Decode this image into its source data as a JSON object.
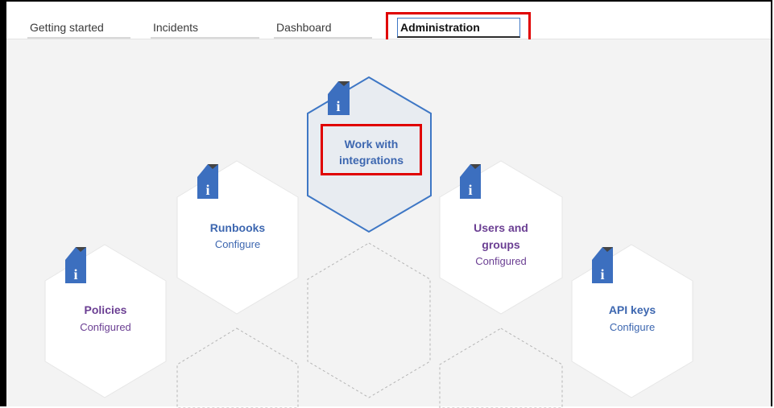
{
  "tabs": {
    "getting_started": "Getting started",
    "incidents": "Incidents",
    "dashboard": "Dashboard",
    "administration": "Administration"
  },
  "tiles": {
    "work_with_integrations": {
      "title": "Work with integrations",
      "title_line1": "Work with",
      "title_line2": "integrations"
    },
    "runbooks": {
      "title": "Runbooks",
      "status": "Configure"
    },
    "users_and_groups": {
      "title_line1": "Users and",
      "title_line2": "groups",
      "status": "Configured"
    },
    "policies": {
      "title": "Policies",
      "status": "Configured"
    },
    "api_keys": {
      "title": "API keys",
      "status": "Configure"
    }
  },
  "info_badge_glyph": "i",
  "colors": {
    "selected_tile_fill": "#e8ecf1",
    "selected_tile_border": "#3e77c5",
    "info_badge": "#3c6fbf",
    "configured_text": "#6b3f93",
    "configure_text": "#3d67b0",
    "highlight": "#e00000"
  }
}
